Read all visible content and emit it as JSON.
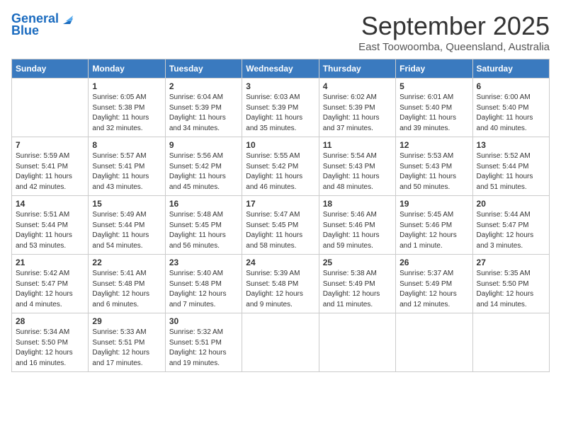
{
  "logo": {
    "line1": "General",
    "line2": "Blue"
  },
  "title": "September 2025",
  "subtitle": "East Toowoomba, Queensland, Australia",
  "days_of_week": [
    "Sunday",
    "Monday",
    "Tuesday",
    "Wednesday",
    "Thursday",
    "Friday",
    "Saturday"
  ],
  "weeks": [
    [
      {
        "day": "",
        "sunrise": "",
        "sunset": "",
        "daylight": ""
      },
      {
        "day": "1",
        "sunrise": "6:05 AM",
        "sunset": "5:38 PM",
        "daylight": "11 hours and 32 minutes."
      },
      {
        "day": "2",
        "sunrise": "6:04 AM",
        "sunset": "5:39 PM",
        "daylight": "11 hours and 34 minutes."
      },
      {
        "day": "3",
        "sunrise": "6:03 AM",
        "sunset": "5:39 PM",
        "daylight": "11 hours and 35 minutes."
      },
      {
        "day": "4",
        "sunrise": "6:02 AM",
        "sunset": "5:39 PM",
        "daylight": "11 hours and 37 minutes."
      },
      {
        "day": "5",
        "sunrise": "6:01 AM",
        "sunset": "5:40 PM",
        "daylight": "11 hours and 39 minutes."
      },
      {
        "day": "6",
        "sunrise": "6:00 AM",
        "sunset": "5:40 PM",
        "daylight": "11 hours and 40 minutes."
      }
    ],
    [
      {
        "day": "7",
        "sunrise": "5:59 AM",
        "sunset": "5:41 PM",
        "daylight": "11 hours and 42 minutes."
      },
      {
        "day": "8",
        "sunrise": "5:57 AM",
        "sunset": "5:41 PM",
        "daylight": "11 hours and 43 minutes."
      },
      {
        "day": "9",
        "sunrise": "5:56 AM",
        "sunset": "5:42 PM",
        "daylight": "11 hours and 45 minutes."
      },
      {
        "day": "10",
        "sunrise": "5:55 AM",
        "sunset": "5:42 PM",
        "daylight": "11 hours and 46 minutes."
      },
      {
        "day": "11",
        "sunrise": "5:54 AM",
        "sunset": "5:43 PM",
        "daylight": "11 hours and 48 minutes."
      },
      {
        "day": "12",
        "sunrise": "5:53 AM",
        "sunset": "5:43 PM",
        "daylight": "11 hours and 50 minutes."
      },
      {
        "day": "13",
        "sunrise": "5:52 AM",
        "sunset": "5:44 PM",
        "daylight": "11 hours and 51 minutes."
      }
    ],
    [
      {
        "day": "14",
        "sunrise": "5:51 AM",
        "sunset": "5:44 PM",
        "daylight": "11 hours and 53 minutes."
      },
      {
        "day": "15",
        "sunrise": "5:49 AM",
        "sunset": "5:44 PM",
        "daylight": "11 hours and 54 minutes."
      },
      {
        "day": "16",
        "sunrise": "5:48 AM",
        "sunset": "5:45 PM",
        "daylight": "11 hours and 56 minutes."
      },
      {
        "day": "17",
        "sunrise": "5:47 AM",
        "sunset": "5:45 PM",
        "daylight": "11 hours and 58 minutes."
      },
      {
        "day": "18",
        "sunrise": "5:46 AM",
        "sunset": "5:46 PM",
        "daylight": "11 hours and 59 minutes."
      },
      {
        "day": "19",
        "sunrise": "5:45 AM",
        "sunset": "5:46 PM",
        "daylight": "12 hours and 1 minute."
      },
      {
        "day": "20",
        "sunrise": "5:44 AM",
        "sunset": "5:47 PM",
        "daylight": "12 hours and 3 minutes."
      }
    ],
    [
      {
        "day": "21",
        "sunrise": "5:42 AM",
        "sunset": "5:47 PM",
        "daylight": "12 hours and 4 minutes."
      },
      {
        "day": "22",
        "sunrise": "5:41 AM",
        "sunset": "5:48 PM",
        "daylight": "12 hours and 6 minutes."
      },
      {
        "day": "23",
        "sunrise": "5:40 AM",
        "sunset": "5:48 PM",
        "daylight": "12 hours and 7 minutes."
      },
      {
        "day": "24",
        "sunrise": "5:39 AM",
        "sunset": "5:48 PM",
        "daylight": "12 hours and 9 minutes."
      },
      {
        "day": "25",
        "sunrise": "5:38 AM",
        "sunset": "5:49 PM",
        "daylight": "12 hours and 11 minutes."
      },
      {
        "day": "26",
        "sunrise": "5:37 AM",
        "sunset": "5:49 PM",
        "daylight": "12 hours and 12 minutes."
      },
      {
        "day": "27",
        "sunrise": "5:35 AM",
        "sunset": "5:50 PM",
        "daylight": "12 hours and 14 minutes."
      }
    ],
    [
      {
        "day": "28",
        "sunrise": "5:34 AM",
        "sunset": "5:50 PM",
        "daylight": "12 hours and 16 minutes."
      },
      {
        "day": "29",
        "sunrise": "5:33 AM",
        "sunset": "5:51 PM",
        "daylight": "12 hours and 17 minutes."
      },
      {
        "day": "30",
        "sunrise": "5:32 AM",
        "sunset": "5:51 PM",
        "daylight": "12 hours and 19 minutes."
      },
      {
        "day": "",
        "sunrise": "",
        "sunset": "",
        "daylight": ""
      },
      {
        "day": "",
        "sunrise": "",
        "sunset": "",
        "daylight": ""
      },
      {
        "day": "",
        "sunrise": "",
        "sunset": "",
        "daylight": ""
      },
      {
        "day": "",
        "sunrise": "",
        "sunset": "",
        "daylight": ""
      }
    ]
  ]
}
